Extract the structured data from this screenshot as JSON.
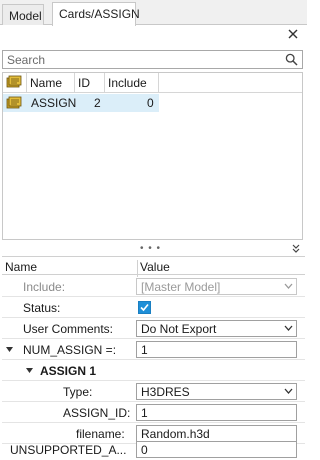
{
  "tabs": [
    {
      "label": "Model"
    },
    {
      "label": "Cards/ASSIGN"
    }
  ],
  "search": {
    "placeholder": "Search"
  },
  "tree": {
    "columns": [
      "Name",
      "ID",
      "Include"
    ],
    "rows": [
      {
        "name": "ASSIGN",
        "id": "2",
        "include": "0"
      }
    ]
  },
  "splitter": {
    "dots": "• • •"
  },
  "grid": {
    "col_name": "Name",
    "col_value": "Value",
    "rows": {
      "include": {
        "label": "Include:",
        "value": "[Master Model]"
      },
      "status": {
        "label": "Status:",
        "checked": true
      },
      "user_comments": {
        "label": "User Comments:",
        "value": "Do Not Export"
      },
      "num_assign": {
        "label": "NUM_ASSIGN =:",
        "value": "1"
      },
      "assign_group": {
        "label": "ASSIGN 1"
      },
      "type": {
        "label": "Type:",
        "value": "H3DRES"
      },
      "assign_id": {
        "label": "ASSIGN_ID:",
        "value": "1"
      },
      "filename": {
        "label": "filename:",
        "value": "Random.h3d"
      },
      "unsupported": {
        "label": "UNSUPPORTED_A...",
        "value": "0"
      }
    }
  },
  "colors": {
    "accent": "#1e8fd8",
    "selection": "#dbeef9",
    "icon_gold": "#c9a227"
  }
}
